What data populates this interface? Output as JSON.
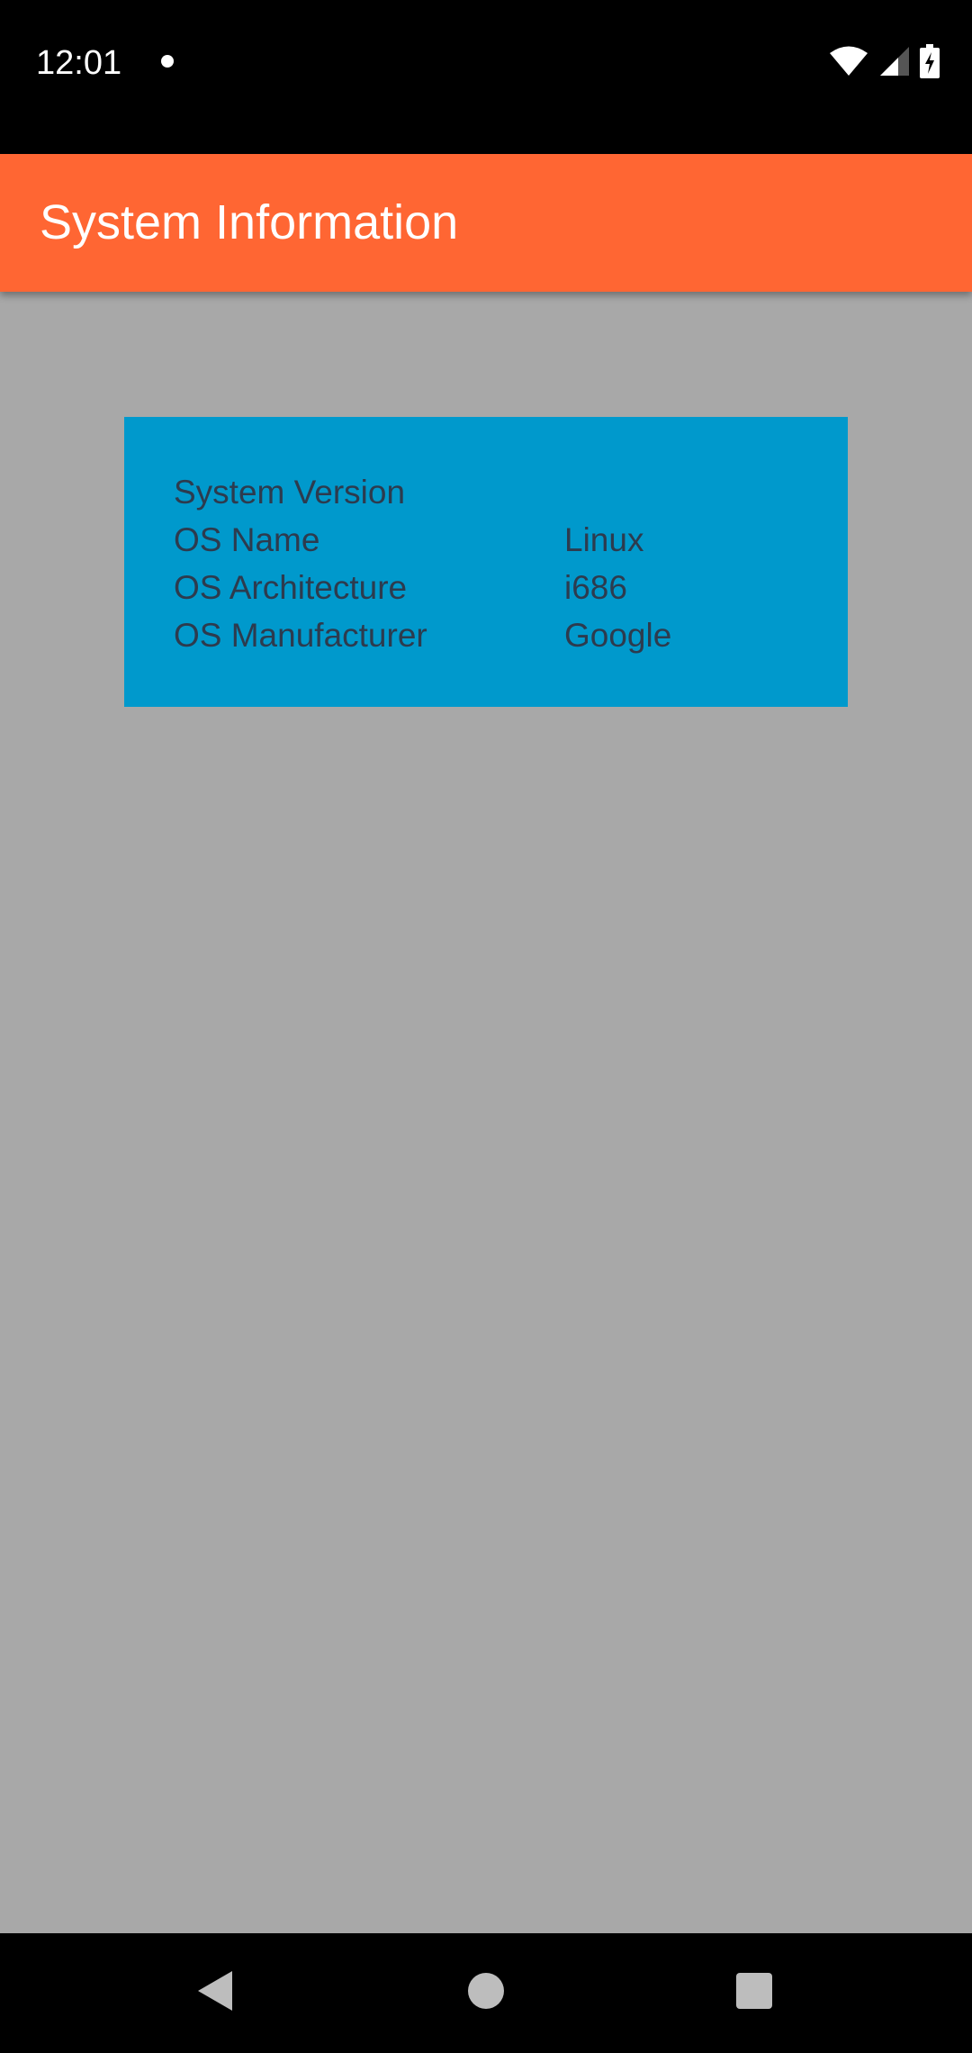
{
  "status_bar": {
    "time": "12:01",
    "icons": [
      "notification-dot-icon",
      "wifi-icon",
      "cellular-signal-icon",
      "battery-charging-icon"
    ]
  },
  "app_bar": {
    "title": "System Information",
    "color": "#FF6633"
  },
  "info_card": {
    "background": "#0099CC",
    "rows": [
      {
        "label": "System Version",
        "value": ""
      },
      {
        "label": "OS Name",
        "value": "Linux"
      },
      {
        "label": "OS Architecture",
        "value": "i686"
      },
      {
        "label": "OS Manufacturer",
        "value": "Google"
      }
    ]
  },
  "content": {
    "background": "#A8A8A8"
  },
  "nav_bar": {
    "buttons": [
      "back-icon",
      "home-icon",
      "recents-icon"
    ]
  }
}
